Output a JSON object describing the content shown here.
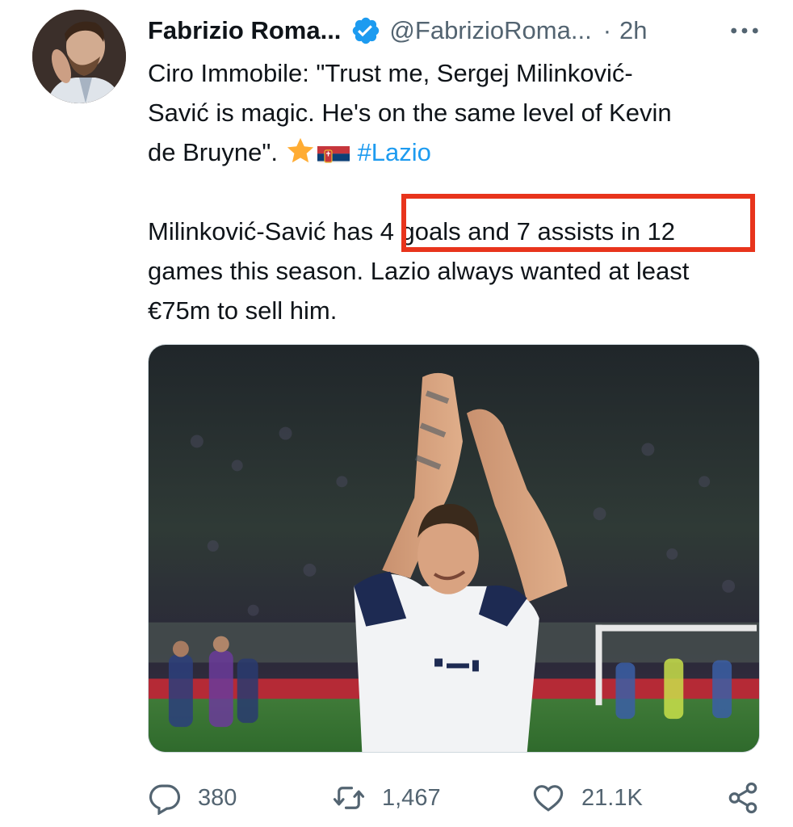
{
  "author": {
    "display_name": "Fabrizio Roma...",
    "handle": "@FabrizioRoma...",
    "separator": "·",
    "time_ago": "2h",
    "verified": true,
    "avatar_icon": "profile-photo"
  },
  "tweet": {
    "paragraph1_line1": "Ciro Immobile: \"Trust me, Sergej Milinković-",
    "paragraph1_line2": "Savić is magic. He's on the same level of Kevin",
    "paragraph1_line3": "de Bruyne\".",
    "emoji": [
      "star-emoji",
      "serbia-flag-emoji"
    ],
    "hashtag": "#Lazio",
    "paragraph2_line1": "Milinković-Savić has 4 goals and 7 assists in 12",
    "paragraph2_line2": "games this season. Lazio always wanted at least",
    "paragraph2_line3": "€75m to sell him."
  },
  "annotation": {
    "highlight_color": "#e8341c",
    "highlighted_text": "4 goals and 7 assists in 12"
  },
  "media": {
    "description_icon": "football-player-photo"
  },
  "actions": {
    "replies": "380",
    "retweets": "1,467",
    "likes": "21.1K"
  },
  "colors": {
    "text": "#0f1419",
    "secondary": "#536471",
    "link": "#1d9bf0",
    "verified": "#1d9bf0"
  }
}
